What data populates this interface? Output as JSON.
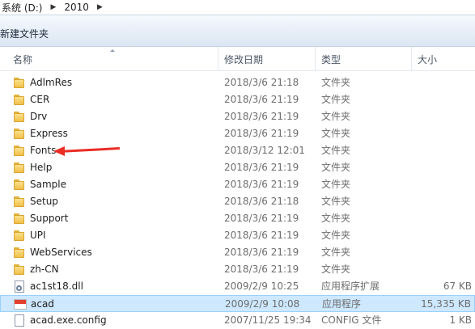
{
  "breadcrumb": [
    "系统 (D:)",
    "2010"
  ],
  "toolbar": {
    "new_folder": "新建文件夹"
  },
  "columns": {
    "name": "名称",
    "date": "修改日期",
    "type": "类型",
    "size": "大小"
  },
  "rows": [
    {
      "name": "AdlmRes",
      "date": "2018/3/6 21:18",
      "type": "文件夹",
      "size": ""
    },
    {
      "name": "CER",
      "date": "2018/3/6 21:19",
      "type": "文件夹",
      "size": ""
    },
    {
      "name": "Drv",
      "date": "2018/3/6 21:19",
      "type": "文件夹",
      "size": ""
    },
    {
      "name": "Express",
      "date": "2018/3/6 21:19",
      "type": "文件夹",
      "size": ""
    },
    {
      "name": "Fonts",
      "date": "2018/3/12 12:01",
      "type": "文件夹",
      "size": ""
    },
    {
      "name": "Help",
      "date": "2018/3/6 21:19",
      "type": "文件夹",
      "size": ""
    },
    {
      "name": "Sample",
      "date": "2018/3/6 21:19",
      "type": "文件夹",
      "size": ""
    },
    {
      "name": "Setup",
      "date": "2018/3/6 21:18",
      "type": "文件夹",
      "size": ""
    },
    {
      "name": "Support",
      "date": "2018/3/6 21:19",
      "type": "文件夹",
      "size": ""
    },
    {
      "name": "UPI",
      "date": "2018/3/6 21:19",
      "type": "文件夹",
      "size": ""
    },
    {
      "name": "WebServices",
      "date": "2018/3/6 21:19",
      "type": "文件夹",
      "size": ""
    },
    {
      "name": "zh-CN",
      "date": "2018/3/6 21:19",
      "type": "文件夹",
      "size": ""
    },
    {
      "name": "ac1st18.dll",
      "date": "2009/2/9 10:25",
      "type": "应用程序扩展",
      "size": "67 KB"
    },
    {
      "name": "acad",
      "date": "2009/2/9 10:08",
      "type": "应用程序",
      "size": "15,335 KB"
    },
    {
      "name": "acad.exe.config",
      "date": "2007/11/25 19:34",
      "type": "CONFIG 文件",
      "size": "1 KB"
    }
  ],
  "colors": {
    "selection": "#cde8ff",
    "annotation_arrow": "#ea2d25"
  }
}
